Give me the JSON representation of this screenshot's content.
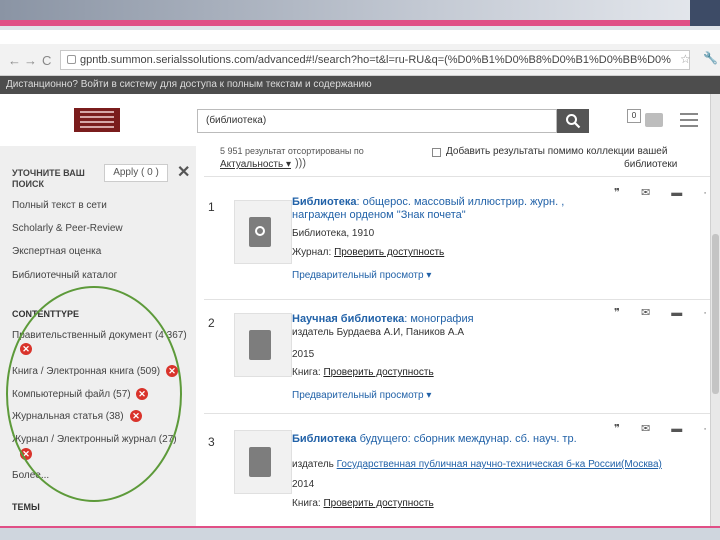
{
  "browser": {
    "back": "←",
    "forward": "→",
    "reload": "C",
    "url": "gpntb.summon.serialssolutions.com/advanced#!/search?ho=t&l=ru-RU&q=(%D0%B1%D0%B8%D0%B1%D0%BB%D0%",
    "star": "☆",
    "wrench": "🔧"
  },
  "banner": {
    "text": "Дистанционно? Войти в систему для доступа к полным текстам и содержанию"
  },
  "header": {
    "search_value": "(библиотека)",
    "cart_count": "0"
  },
  "sidebar": {
    "title": "УТОЧНИТЕ ВАШ ПОИСК",
    "apply_label": "Apply ( 0 )",
    "close": "✕",
    "filters": [
      "Полный текст в сети",
      "Scholarly & Peer-Review",
      "Экспертная оценка",
      "Библиотечный каталог"
    ],
    "content_type_heading": "CONTENTTYPE",
    "content_types": [
      "Правительственный документ (4 367)",
      "Книга / Электронная книга (509)",
      "Компьютерный файл (57)",
      "Журнальная статья (38)",
      "Журнал / Электронный журнал (27)"
    ],
    "more": "Более...",
    "next_heading": "ТЕМЫ"
  },
  "results": {
    "count_text": "5 951 результат отсортированы по",
    "sort_label": "Актуальность ▾",
    "add_results_label": "Добавить результаты помимо коллекции вашей",
    "add_results_label2": "библиотеки",
    "tools": "❞ ✉ ▬ ···",
    "items": [
      {
        "num": "1",
        "title_bold": "Библиотека",
        "title_rest": ": общерос. массовый  иллюстрир. журн. , награжден орденом \"Знак почета\"",
        "line1": "Библиотека, 1910",
        "line2_label": "Журнал:",
        "line2_link": "Проверить доступность",
        "preview": "Предварительный просмотр ▾"
      },
      {
        "num": "2",
        "title_bold": "Научная библиотека",
        "title_rest": ": монография",
        "line1": "издатель Бурдаева А.И, Паников А.А",
        "line2": "2015",
        "line3_label": "Книга:",
        "line3_link": "Проверить доступность",
        "preview": "Предварительный просмотр ▾"
      },
      {
        "num": "3",
        "title_bold": "Библиотека",
        "title_rest": " будущего: сборник  междунар. сб. науч. тр.",
        "line1_label": "издатель",
        "line1_link": "Государственная публичная научно-техническая б-ка России(Москва)",
        "line2": "2014",
        "line3_label": "Книга:",
        "line3_link": "Проверить доступность"
      }
    ]
  },
  "colors": {
    "accent": "#e04f86",
    "link": "#2262a8",
    "remove": "#d9332b",
    "highlight": "#5d9a3a"
  }
}
